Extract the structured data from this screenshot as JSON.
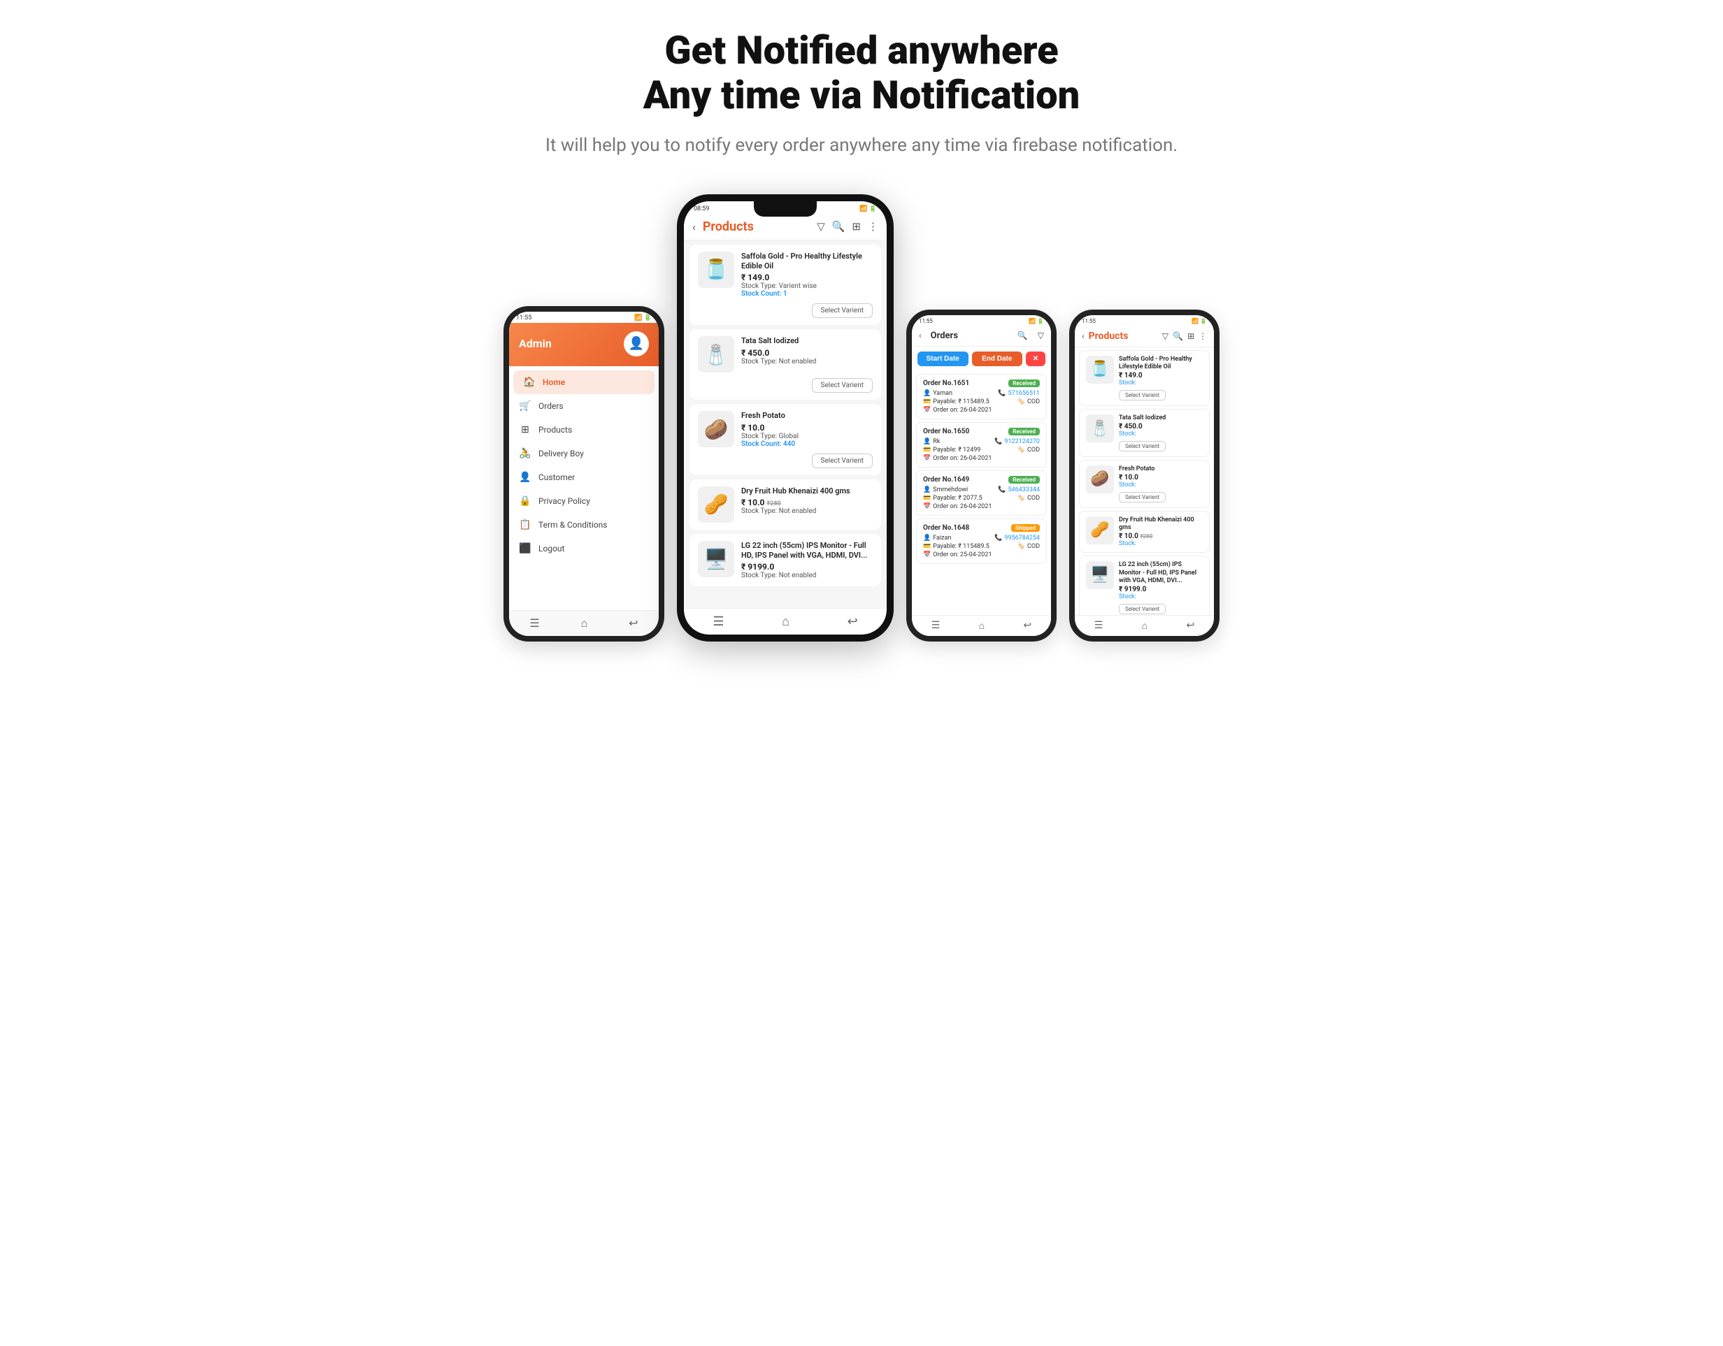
{
  "hero": {
    "title_line1": "Get Notified anywhere",
    "title_line2": "Any time via Notification",
    "subtitle": "It will help you to notify every order anywhere any time via firebase notification."
  },
  "left_phone": {
    "status": "11:55",
    "header": {
      "admin_label": "Admin"
    },
    "nav": [
      {
        "icon": "🏠",
        "label": "Home",
        "active": true
      },
      {
        "icon": "🛒",
        "label": "Orders",
        "active": false
      },
      {
        "icon": "⊞",
        "label": "Products",
        "active": false
      },
      {
        "icon": "🚴",
        "label": "Delivery Boy",
        "active": false
      },
      {
        "icon": "👤",
        "label": "Customer",
        "active": false
      },
      {
        "icon": "🔒",
        "label": "Privacy Policy",
        "active": false
      },
      {
        "icon": "📋",
        "label": "Term & Conditions",
        "active": false
      },
      {
        "icon": "⬛",
        "label": "Logout",
        "active": false
      }
    ]
  },
  "center_phone": {
    "status": "08:59",
    "title": "Products",
    "products": [
      {
        "emoji": "🫙",
        "name": "Saffola Gold - Pro Healthy Lifestyle Edible Oil",
        "price": "₹ 149.0",
        "stock_type": "Stock Type: Varient wise",
        "stock_count": "Stock Count: 1",
        "has_button": true
      },
      {
        "emoji": "🧂",
        "name": "Tata Salt Iodized",
        "price": "₹ 450.0",
        "stock_type": "Stock Type: Not enabled",
        "stock_count": "",
        "has_button": true
      },
      {
        "emoji": "🥔",
        "name": "Fresh Potato",
        "price": "₹ 10.0",
        "stock_type": "Stock Type: Global",
        "stock_count": "Stock Count: 440",
        "has_button": true
      },
      {
        "emoji": "🥜",
        "name": "Dry Fruit Hub Khenaizi 400 gms",
        "price": "₹ 10.0  ₹280",
        "stock_type": "Stock Type: Not enabled",
        "stock_count": "",
        "has_button": false
      },
      {
        "emoji": "🖥️",
        "name": "LG 22 inch (55cm) IPS Monitor - Full HD, IPS Panel with VGA, HDMI, DVI...",
        "price": "₹ 9199.0",
        "stock_type": "Stock Type: Not enabled",
        "stock_count": "",
        "has_button": false
      }
    ]
  },
  "orders_phone": {
    "status": "11:55",
    "title": "Orders",
    "filter": {
      "start": "Start Date",
      "end": "End Date",
      "clear": "✕"
    },
    "orders": [
      {
        "number": "Order No.1651",
        "badge": "Received",
        "badge_type": "received",
        "customer": "Yaman",
        "phone": "571656511",
        "payable": "Payable: ₹ 115489.5",
        "payment": "COD",
        "date": "Order on: 26-04-2021"
      },
      {
        "number": "Order No.1650",
        "badge": "Received",
        "badge_type": "received",
        "customer": "Rk",
        "phone": "9122124270",
        "payable": "Payable: ₹ 12499",
        "payment": "COD",
        "date": "Order on: 26-04-2021"
      },
      {
        "number": "Order No.1649",
        "badge": "Received",
        "badge_type": "received",
        "customer": "Smmehdowi",
        "phone": "546433344",
        "payable": "Payable: ₹ 2077.5",
        "payment": "COD",
        "date": "Order on: 26-04-2021"
      },
      {
        "number": "Order No.1648",
        "badge": "Shipped",
        "badge_type": "shipped",
        "customer": "Faizan",
        "phone": "9956784254",
        "payable": "Payable: ₹ 115489.5",
        "payment": "COD",
        "date": "Order on: 25-04-2021"
      }
    ]
  },
  "right_phone": {
    "status": "11:55",
    "title": "Products",
    "products": [
      {
        "emoji": "🫙",
        "name": "Saffola Gold - Pro Healthy Lifestyle Edible Oil",
        "price": "₹ 149.0",
        "stock": "Stock:",
        "has_button": true
      },
      {
        "emoji": "🧂",
        "name": "Tata Salt Iodized",
        "price": "₹ 450.0",
        "stock": "Stock:",
        "has_button": true
      },
      {
        "emoji": "🥔",
        "name": "Fresh Potato",
        "price": "₹ 10.0",
        "stock": "Stock:",
        "has_button": true
      },
      {
        "emoji": "🥜",
        "name": "Dry Fruit Hub Khenaizi 400 gms",
        "price": "₹ 10.0  ₹280",
        "stock": "Stock:",
        "has_button": false
      },
      {
        "emoji": "🖥️",
        "name": "LG 22 inch (55cm) IPS Monitor - Full HD, IPS Panel with VGA, HDMI, DVI...",
        "price": "₹ 9199.0",
        "stock": "Stock:",
        "has_button": true
      }
    ]
  }
}
